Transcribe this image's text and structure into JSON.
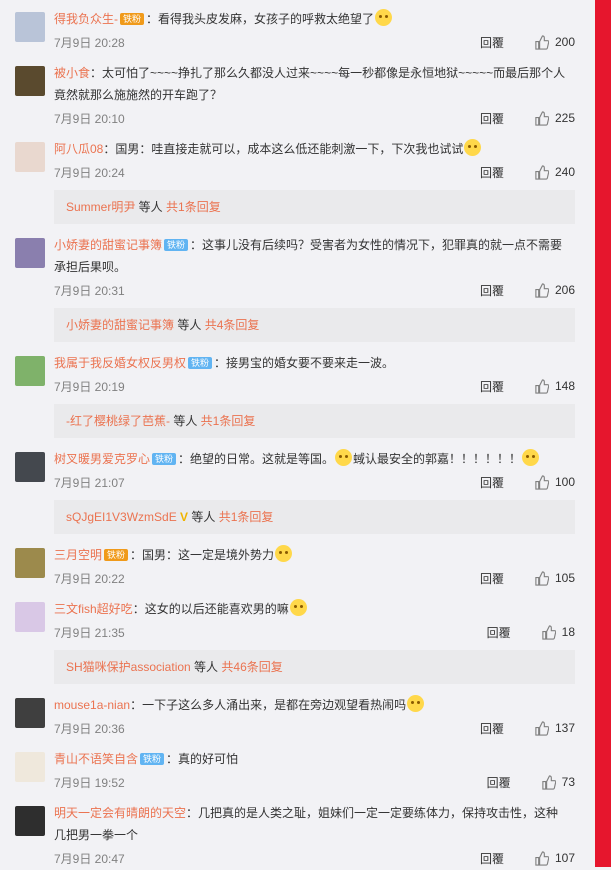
{
  "reply_label": "回覆",
  "comments": [
    {
      "user": "得我负众生-",
      "badge": "铁粉",
      "badge_color": "#f09a1a",
      "text": "：看得我头皮发麻，女孩子的呼救太绝望了",
      "time": "7月9日 20:28",
      "likes": "200",
      "avatar_color": "#b9c4d8",
      "emoji": true
    },
    {
      "user": "被小食",
      "badge": "",
      "text": "：太可怕了~~~~挣扎了那么久都没人过来~~~~每一秒都像是永恒地狱~~~~~而最后那个人竟然就那么施施然的开车跑了？",
      "time": "7月9日 20:10",
      "likes": "225",
      "avatar_color": "#5a4a2e"
    },
    {
      "user": "阿八瓜08",
      "badge": "",
      "text": "：国男：哇直接走就可以，成本这么低还能刺激一下，下次我也试试",
      "time": "7月9日 20:24",
      "likes": "240",
      "avatar_color": "#e9d8cf",
      "emoji": true,
      "more": {
        "who": "Summer明尹",
        "mid": " 等人 ",
        "count": "共1条回复"
      }
    },
    {
      "user": "小娇妻的甜蜜记事簿",
      "badge": "铁粉",
      "badge_color": "#61b4f2",
      "text": "：这事儿没有后续吗？受害者为女性的情况下，犯罪真的就一点不需要承担后果呗。",
      "time": "7月9日 20:31",
      "likes": "206",
      "avatar_color": "#8a7fae",
      "more": {
        "who": "小娇妻的甜蜜记事簿",
        "mid": " 等人 ",
        "count": "共4条回复"
      }
    },
    {
      "user": "我属于我反婚女权反男权",
      "badge": "铁粉",
      "badge_color": "#61b4f2",
      "text": "：接男宝的婚女要不要来走一波。",
      "time": "7月9日 20:19",
      "likes": "148",
      "avatar_color": "#7fb26a",
      "more": {
        "who": "-红了樱桃绿了芭蕉-",
        "mid": " 等人 ",
        "count": "共1条回复"
      }
    },
    {
      "user": "树叉暖男爱克罗心",
      "badge": "铁粉",
      "badge_color": "#61b4f2",
      "text": "：绝望的日常。这就是等国。",
      "text2": "蜮认最安全的郭嘉！！！！！！",
      "time": "7月9日 21:07",
      "likes": "100",
      "avatar_color": "#44484e",
      "emoji": true,
      "more": {
        "who": "sQJgEI1V3WzmSdE",
        "v": "V",
        "mid": " 等人 ",
        "count": "共1条回复"
      }
    },
    {
      "user": "三月空明",
      "badge": "铁粉",
      "badge_color": "#f09a1a",
      "text": "：国男：这一定是境外势力",
      "time": "7月9日 20:22",
      "likes": "105",
      "avatar_color": "#9c8a4c",
      "emoji": true
    },
    {
      "user": "三文fish超好吃",
      "badge": "",
      "text": "：这女的以后还能喜欢男的嘛",
      "time": "7月9日 21:35",
      "likes": "18",
      "avatar_color": "#d9c8e6",
      "emoji": true,
      "more": {
        "who": "SH猫咪保护association",
        "mid": " 等人 ",
        "count": "共46条回复"
      }
    },
    {
      "user": "mouse1a-nian",
      "badge": "",
      "text": "：一下子这么多人涌出来，是都在旁边观望看热闹吗",
      "time": "7月9日 20:36",
      "likes": "137",
      "avatar_color": "#3f3f3f",
      "emoji": true
    },
    {
      "user": "青山不语笑自含",
      "badge": "铁粉",
      "badge_color": "#61b4f2",
      "text": "：真的好可怕",
      "time": "7月9日 19:52",
      "likes": "73",
      "avatar_color": "#efe8dc"
    },
    {
      "user": "明天一定会有晴朗的天空",
      "badge": "",
      "text": "：几把真的是人类之耻，姐妹们一定一定要练体力，保持攻击性，这种几把男一拳一个",
      "time": "7月9日 20:47",
      "likes": "107",
      "avatar_color": "#2e2e2e"
    }
  ]
}
